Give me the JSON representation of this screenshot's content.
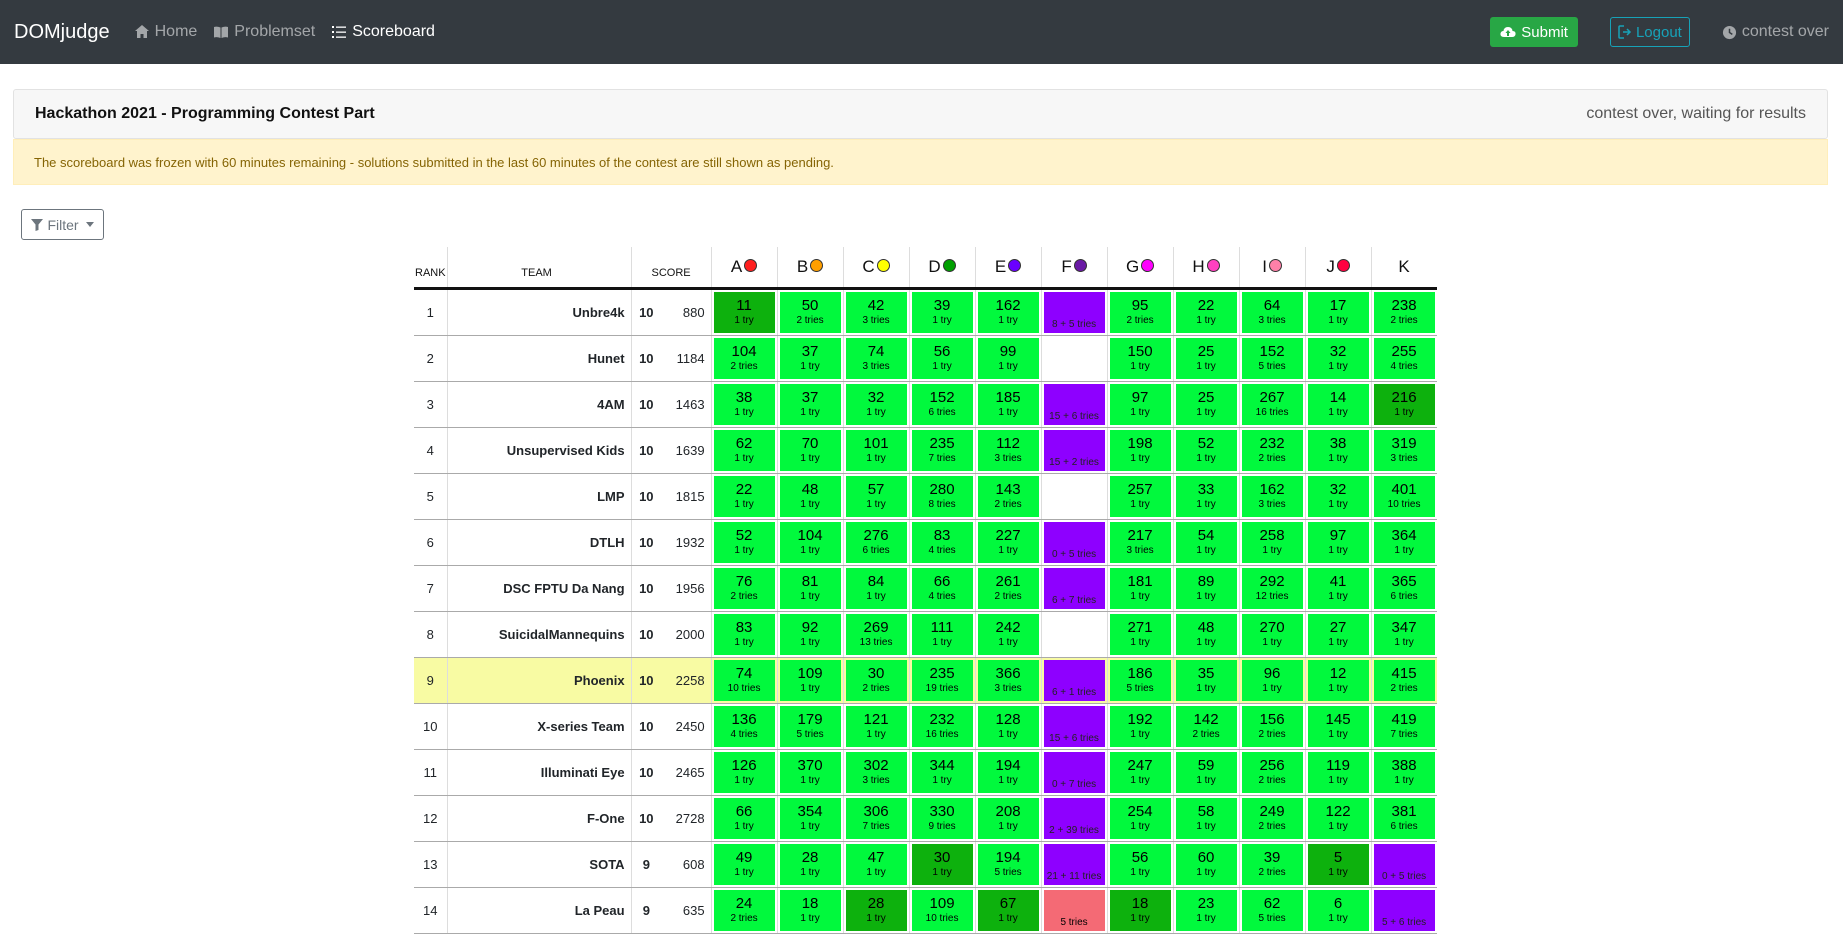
{
  "nav": {
    "brand": "DOMjudge",
    "home": "Home",
    "problemset": "Problemset",
    "scoreboard": "Scoreboard",
    "submit": "Submit",
    "logout": "Logout",
    "status": "contest over"
  },
  "contest": {
    "title": "Hackathon 2021 - Programming Contest Part",
    "state": "contest over, waiting for results",
    "freeze_notice": "The scoreboard was frozen with 60 minutes remaining - solutions submitted in the last 60 minutes of the contest are still shown as pending."
  },
  "filter_label": "Filter",
  "headers": {
    "rank": "RANK",
    "team": "TEAM",
    "score": "SCORE"
  },
  "problems": [
    {
      "label": "A",
      "color": "#ff1f1f"
    },
    {
      "label": "B",
      "color": "#ff9f00"
    },
    {
      "label": "C",
      "color": "#ffff00"
    },
    {
      "label": "D",
      "color": "#00a000"
    },
    {
      "label": "E",
      "color": "#6a00ff"
    },
    {
      "label": "F",
      "color": "#6a1aa5"
    },
    {
      "label": "G",
      "color": "#ff00ff"
    },
    {
      "label": "H",
      "color": "#ff40c0"
    },
    {
      "label": "I",
      "color": "#ff80a8"
    },
    {
      "label": "J",
      "color": "#ff0040"
    },
    {
      "label": "K",
      "color": ""
    }
  ],
  "rows": [
    {
      "rank": "1",
      "team": "Unbre4k",
      "solved": "10",
      "time": "880",
      "highlight": false,
      "cells": [
        {
          "s": "first",
          "t": "11",
          "n": "1 try"
        },
        {
          "s": "correct",
          "t": "50",
          "n": "2 tries"
        },
        {
          "s": "correct",
          "t": "42",
          "n": "3 tries"
        },
        {
          "s": "correct",
          "t": "39",
          "n": "1 try"
        },
        {
          "s": "correct",
          "t": "162",
          "n": "1 try"
        },
        {
          "s": "pending",
          "t": "",
          "n": "8 + 5 tries"
        },
        {
          "s": "correct",
          "t": "95",
          "n": "2 tries"
        },
        {
          "s": "correct",
          "t": "22",
          "n": "1 try"
        },
        {
          "s": "correct",
          "t": "64",
          "n": "3 tries"
        },
        {
          "s": "correct",
          "t": "17",
          "n": "1 try"
        },
        {
          "s": "correct",
          "t": "238",
          "n": "2 tries"
        }
      ]
    },
    {
      "rank": "2",
      "team": "Hunet",
      "solved": "10",
      "time": "1184",
      "highlight": false,
      "cells": [
        {
          "s": "correct",
          "t": "104",
          "n": "2 tries"
        },
        {
          "s": "correct",
          "t": "37",
          "n": "1 try"
        },
        {
          "s": "correct",
          "t": "74",
          "n": "3 tries"
        },
        {
          "s": "correct",
          "t": "56",
          "n": "1 try"
        },
        {
          "s": "correct",
          "t": "99",
          "n": "1 try"
        },
        {
          "s": "empty",
          "t": "",
          "n": ""
        },
        {
          "s": "correct",
          "t": "150",
          "n": "1 try"
        },
        {
          "s": "correct",
          "t": "25",
          "n": "1 try"
        },
        {
          "s": "correct",
          "t": "152",
          "n": "5 tries"
        },
        {
          "s": "correct",
          "t": "32",
          "n": "1 try"
        },
        {
          "s": "correct",
          "t": "255",
          "n": "4 tries"
        }
      ]
    },
    {
      "rank": "3",
      "team": "4AM",
      "solved": "10",
      "time": "1463",
      "highlight": false,
      "cells": [
        {
          "s": "correct",
          "t": "38",
          "n": "1 try"
        },
        {
          "s": "correct",
          "t": "37",
          "n": "1 try"
        },
        {
          "s": "correct",
          "t": "32",
          "n": "1 try"
        },
        {
          "s": "correct",
          "t": "152",
          "n": "6 tries"
        },
        {
          "s": "correct",
          "t": "185",
          "n": "1 try"
        },
        {
          "s": "pending",
          "t": "",
          "n": "15 + 6 tries"
        },
        {
          "s": "correct",
          "t": "97",
          "n": "1 try"
        },
        {
          "s": "correct",
          "t": "25",
          "n": "1 try"
        },
        {
          "s": "correct",
          "t": "267",
          "n": "16 tries"
        },
        {
          "s": "correct",
          "t": "14",
          "n": "1 try"
        },
        {
          "s": "first",
          "t": "216",
          "n": "1 try"
        }
      ]
    },
    {
      "rank": "4",
      "team": "Unsupervised Kids",
      "solved": "10",
      "time": "1639",
      "highlight": false,
      "cells": [
        {
          "s": "correct",
          "t": "62",
          "n": "1 try"
        },
        {
          "s": "correct",
          "t": "70",
          "n": "1 try"
        },
        {
          "s": "correct",
          "t": "101",
          "n": "1 try"
        },
        {
          "s": "correct",
          "t": "235",
          "n": "7 tries"
        },
        {
          "s": "correct",
          "t": "112",
          "n": "3 tries"
        },
        {
          "s": "pending",
          "t": "",
          "n": "15 + 2 tries"
        },
        {
          "s": "correct",
          "t": "198",
          "n": "1 try"
        },
        {
          "s": "correct",
          "t": "52",
          "n": "1 try"
        },
        {
          "s": "correct",
          "t": "232",
          "n": "2 tries"
        },
        {
          "s": "correct",
          "t": "38",
          "n": "1 try"
        },
        {
          "s": "correct",
          "t": "319",
          "n": "3 tries"
        }
      ]
    },
    {
      "rank": "5",
      "team": "LMP",
      "solved": "10",
      "time": "1815",
      "highlight": false,
      "cells": [
        {
          "s": "correct",
          "t": "22",
          "n": "1 try"
        },
        {
          "s": "correct",
          "t": "48",
          "n": "1 try"
        },
        {
          "s": "correct",
          "t": "57",
          "n": "1 try"
        },
        {
          "s": "correct",
          "t": "280",
          "n": "8 tries"
        },
        {
          "s": "correct",
          "t": "143",
          "n": "2 tries"
        },
        {
          "s": "empty",
          "t": "",
          "n": ""
        },
        {
          "s": "correct",
          "t": "257",
          "n": "1 try"
        },
        {
          "s": "correct",
          "t": "33",
          "n": "1 try"
        },
        {
          "s": "correct",
          "t": "162",
          "n": "3 tries"
        },
        {
          "s": "correct",
          "t": "32",
          "n": "1 try"
        },
        {
          "s": "correct",
          "t": "401",
          "n": "10 tries"
        }
      ]
    },
    {
      "rank": "6",
      "team": "DTLH",
      "solved": "10",
      "time": "1932",
      "highlight": false,
      "cells": [
        {
          "s": "correct",
          "t": "52",
          "n": "1 try"
        },
        {
          "s": "correct",
          "t": "104",
          "n": "1 try"
        },
        {
          "s": "correct",
          "t": "276",
          "n": "6 tries"
        },
        {
          "s": "correct",
          "t": "83",
          "n": "4 tries"
        },
        {
          "s": "correct",
          "t": "227",
          "n": "1 try"
        },
        {
          "s": "pending",
          "t": "",
          "n": "0 + 5 tries"
        },
        {
          "s": "correct",
          "t": "217",
          "n": "3 tries"
        },
        {
          "s": "correct",
          "t": "54",
          "n": "1 try"
        },
        {
          "s": "correct",
          "t": "258",
          "n": "1 try"
        },
        {
          "s": "correct",
          "t": "97",
          "n": "1 try"
        },
        {
          "s": "correct",
          "t": "364",
          "n": "1 try"
        }
      ]
    },
    {
      "rank": "7",
      "team": "DSC FPTU Da Nang",
      "solved": "10",
      "time": "1956",
      "highlight": false,
      "cells": [
        {
          "s": "correct",
          "t": "76",
          "n": "2 tries"
        },
        {
          "s": "correct",
          "t": "81",
          "n": "1 try"
        },
        {
          "s": "correct",
          "t": "84",
          "n": "1 try"
        },
        {
          "s": "correct",
          "t": "66",
          "n": "4 tries"
        },
        {
          "s": "correct",
          "t": "261",
          "n": "2 tries"
        },
        {
          "s": "pending",
          "t": "",
          "n": "6 + 7 tries"
        },
        {
          "s": "correct",
          "t": "181",
          "n": "1 try"
        },
        {
          "s": "correct",
          "t": "89",
          "n": "1 try"
        },
        {
          "s": "correct",
          "t": "292",
          "n": "12 tries"
        },
        {
          "s": "correct",
          "t": "41",
          "n": "1 try"
        },
        {
          "s": "correct",
          "t": "365",
          "n": "6 tries"
        }
      ]
    },
    {
      "rank": "8",
      "team": "SuicidalMannequins",
      "solved": "10",
      "time": "2000",
      "highlight": false,
      "cells": [
        {
          "s": "correct",
          "t": "83",
          "n": "1 try"
        },
        {
          "s": "correct",
          "t": "92",
          "n": "1 try"
        },
        {
          "s": "correct",
          "t": "269",
          "n": "13 tries"
        },
        {
          "s": "correct",
          "t": "111",
          "n": "1 try"
        },
        {
          "s": "correct",
          "t": "242",
          "n": "1 try"
        },
        {
          "s": "empty",
          "t": "",
          "n": ""
        },
        {
          "s": "correct",
          "t": "271",
          "n": "1 try"
        },
        {
          "s": "correct",
          "t": "48",
          "n": "1 try"
        },
        {
          "s": "correct",
          "t": "270",
          "n": "1 try"
        },
        {
          "s": "correct",
          "t": "27",
          "n": "1 try"
        },
        {
          "s": "correct",
          "t": "347",
          "n": "1 try"
        }
      ]
    },
    {
      "rank": "9",
      "team": "Phoenix",
      "solved": "10",
      "time": "2258",
      "highlight": true,
      "cells": [
        {
          "s": "correct",
          "t": "74",
          "n": "10 tries"
        },
        {
          "s": "correct",
          "t": "109",
          "n": "1 try"
        },
        {
          "s": "correct",
          "t": "30",
          "n": "2 tries"
        },
        {
          "s": "correct",
          "t": "235",
          "n": "19 tries"
        },
        {
          "s": "correct",
          "t": "366",
          "n": "3 tries"
        },
        {
          "s": "pending",
          "t": "",
          "n": "6 + 1 tries"
        },
        {
          "s": "correct",
          "t": "186",
          "n": "5 tries"
        },
        {
          "s": "correct",
          "t": "35",
          "n": "1 try"
        },
        {
          "s": "correct",
          "t": "96",
          "n": "1 try"
        },
        {
          "s": "correct",
          "t": "12",
          "n": "1 try"
        },
        {
          "s": "correct",
          "t": "415",
          "n": "2 tries"
        }
      ]
    },
    {
      "rank": "10",
      "team": "X-series Team",
      "solved": "10",
      "time": "2450",
      "highlight": false,
      "cells": [
        {
          "s": "correct",
          "t": "136",
          "n": "4 tries"
        },
        {
          "s": "correct",
          "t": "179",
          "n": "5 tries"
        },
        {
          "s": "correct",
          "t": "121",
          "n": "1 try"
        },
        {
          "s": "correct",
          "t": "232",
          "n": "16 tries"
        },
        {
          "s": "correct",
          "t": "128",
          "n": "1 try"
        },
        {
          "s": "pending",
          "t": "",
          "n": "15 + 6 tries"
        },
        {
          "s": "correct",
          "t": "192",
          "n": "1 try"
        },
        {
          "s": "correct",
          "t": "142",
          "n": "2 tries"
        },
        {
          "s": "correct",
          "t": "156",
          "n": "2 tries"
        },
        {
          "s": "correct",
          "t": "145",
          "n": "1 try"
        },
        {
          "s": "correct",
          "t": "419",
          "n": "7 tries"
        }
      ]
    },
    {
      "rank": "11",
      "team": "Illuminati Eye",
      "solved": "10",
      "time": "2465",
      "highlight": false,
      "cells": [
        {
          "s": "correct",
          "t": "126",
          "n": "1 try"
        },
        {
          "s": "correct",
          "t": "370",
          "n": "1 try"
        },
        {
          "s": "correct",
          "t": "302",
          "n": "3 tries"
        },
        {
          "s": "correct",
          "t": "344",
          "n": "1 try"
        },
        {
          "s": "correct",
          "t": "194",
          "n": "1 try"
        },
        {
          "s": "pending",
          "t": "",
          "n": "0 + 7 tries"
        },
        {
          "s": "correct",
          "t": "247",
          "n": "1 try"
        },
        {
          "s": "correct",
          "t": "59",
          "n": "1 try"
        },
        {
          "s": "correct",
          "t": "256",
          "n": "2 tries"
        },
        {
          "s": "correct",
          "t": "119",
          "n": "1 try"
        },
        {
          "s": "correct",
          "t": "388",
          "n": "1 try"
        }
      ]
    },
    {
      "rank": "12",
      "team": "F-One",
      "solved": "10",
      "time": "2728",
      "highlight": false,
      "cells": [
        {
          "s": "correct",
          "t": "66",
          "n": "1 try"
        },
        {
          "s": "correct",
          "t": "354",
          "n": "1 try"
        },
        {
          "s": "correct",
          "t": "306",
          "n": "7 tries"
        },
        {
          "s": "correct",
          "t": "330",
          "n": "9 tries"
        },
        {
          "s": "correct",
          "t": "208",
          "n": "1 try"
        },
        {
          "s": "pending",
          "t": "",
          "n": "2 + 39 tries"
        },
        {
          "s": "correct",
          "t": "254",
          "n": "1 try"
        },
        {
          "s": "correct",
          "t": "58",
          "n": "1 try"
        },
        {
          "s": "correct",
          "t": "249",
          "n": "2 tries"
        },
        {
          "s": "correct",
          "t": "122",
          "n": "1 try"
        },
        {
          "s": "correct",
          "t": "381",
          "n": "6 tries"
        }
      ]
    },
    {
      "rank": "13",
      "team": "SOTA",
      "solved": "9",
      "time": "608",
      "highlight": false,
      "cells": [
        {
          "s": "correct",
          "t": "49",
          "n": "1 try"
        },
        {
          "s": "correct",
          "t": "28",
          "n": "1 try"
        },
        {
          "s": "correct",
          "t": "47",
          "n": "1 try"
        },
        {
          "s": "first",
          "t": "30",
          "n": "1 try"
        },
        {
          "s": "correct",
          "t": "194",
          "n": "5 tries"
        },
        {
          "s": "pending",
          "t": "",
          "n": "21 + 11 tries"
        },
        {
          "s": "correct",
          "t": "56",
          "n": "1 try"
        },
        {
          "s": "correct",
          "t": "60",
          "n": "1 try"
        },
        {
          "s": "correct",
          "t": "39",
          "n": "2 tries"
        },
        {
          "s": "first",
          "t": "5",
          "n": "1 try"
        },
        {
          "s": "pending",
          "t": "",
          "n": "0 + 5 tries"
        }
      ]
    },
    {
      "rank": "14",
      "team": "La Peau",
      "solved": "9",
      "time": "635",
      "highlight": false,
      "cells": [
        {
          "s": "correct",
          "t": "24",
          "n": "2 tries"
        },
        {
          "s": "correct",
          "t": "18",
          "n": "1 try"
        },
        {
          "s": "first",
          "t": "28",
          "n": "1 try"
        },
        {
          "s": "correct",
          "t": "109",
          "n": "10 tries"
        },
        {
          "s": "first",
          "t": "67",
          "n": "1 try"
        },
        {
          "s": "incorrect",
          "t": "",
          "n": "5 tries"
        },
        {
          "s": "first",
          "t": "18",
          "n": "1 try"
        },
        {
          "s": "correct",
          "t": "23",
          "n": "1 try"
        },
        {
          "s": "correct",
          "t": "62",
          "n": "5 tries"
        },
        {
          "s": "correct",
          "t": "6",
          "n": "1 try"
        },
        {
          "s": "pending",
          "t": "",
          "n": "5 + 6 tries"
        }
      ]
    }
  ]
}
